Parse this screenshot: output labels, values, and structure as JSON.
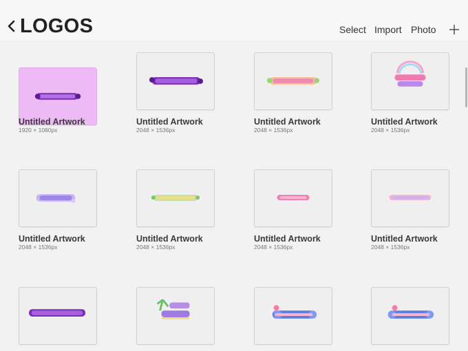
{
  "header": {
    "title": "LOGOS",
    "select_label": "Select",
    "import_label": "Import",
    "photo_label": "Photo"
  },
  "icons": {
    "back": "chevron-left-icon",
    "add": "plus-icon"
  },
  "colors": {
    "background": "#f2f2f2",
    "thumbnail_background": "#efefef",
    "pink_canvas": "#eebaf6",
    "logo_purple": "#8e3fc8",
    "logo_pink": "#f07bb0",
    "logo_green": "#9fd27b",
    "logo_blue": "#5f7fe0"
  },
  "artworks": [
    {
      "title": "Untitled Artwork",
      "size": "1920 × 1080px"
    },
    {
      "title": "Untitled Artwork",
      "size": "2048 × 1536px"
    },
    {
      "title": "Untitled Artwork",
      "size": "2048 × 1536px"
    },
    {
      "title": "Untitled Artwork",
      "size": "2048 × 1536px"
    },
    {
      "title": "Untitled Artwork",
      "size": "2048 × 1536px"
    },
    {
      "title": "Untitled Artwork",
      "size": "2048 × 1536px"
    },
    {
      "title": "Untitled Artwork",
      "size": "2048 × 1536px"
    },
    {
      "title": "Untitled Artwork",
      "size": "2048 × 1536px"
    },
    {
      "title": "",
      "size": ""
    },
    {
      "title": "",
      "size": ""
    },
    {
      "title": "",
      "size": ""
    },
    {
      "title": "",
      "size": ""
    }
  ]
}
